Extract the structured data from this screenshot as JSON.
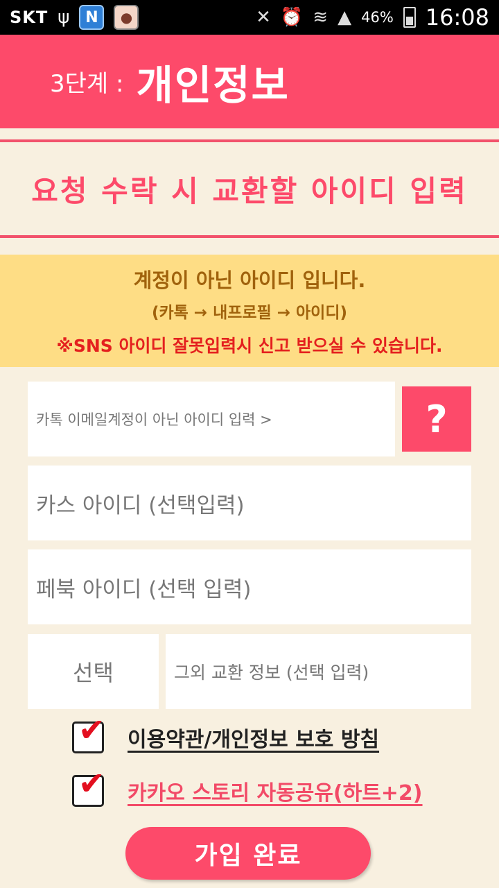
{
  "status_bar": {
    "carrier": "SKT",
    "battery": "46%",
    "time": "16:08",
    "icons": [
      "usb-icon",
      "n-app-icon",
      "app-icon",
      "mute-icon",
      "alarm-icon",
      "wifi-icon",
      "signal-icon",
      "battery-icon"
    ]
  },
  "header": {
    "step": "3단계 :",
    "title": "개인정보",
    "color": "#fd4a6a"
  },
  "subtitle": "요청 수락 시 교환할 아이디 입력",
  "notice": {
    "line1": "계정이 아닌 아이디 입니다.",
    "line2": "(카톡 → 내프로필 → 아이디)",
    "line3": "※SNS 아이디 잘못입력시 신고 받으실 수 있습니다."
  },
  "form": {
    "kakao_id_placeholder": "카톡 이메일계정이 아닌 아이디 입력 >",
    "help_label": "?",
    "kakaostory_placeholder": "카스 아이디 (선택입력)",
    "facebook_placeholder": "페북 아이디 (선택 입력)",
    "select_label": "선택",
    "other_placeholder": "그외 교환 정보 (선택 입력)"
  },
  "checks": {
    "terms_label": "이용약관/개인정보 보호 방침",
    "terms_checked": true,
    "share_label": "카카오 스토리 자동공유(하트+2)",
    "share_checked": true
  },
  "submit_label": "가입 완료"
}
